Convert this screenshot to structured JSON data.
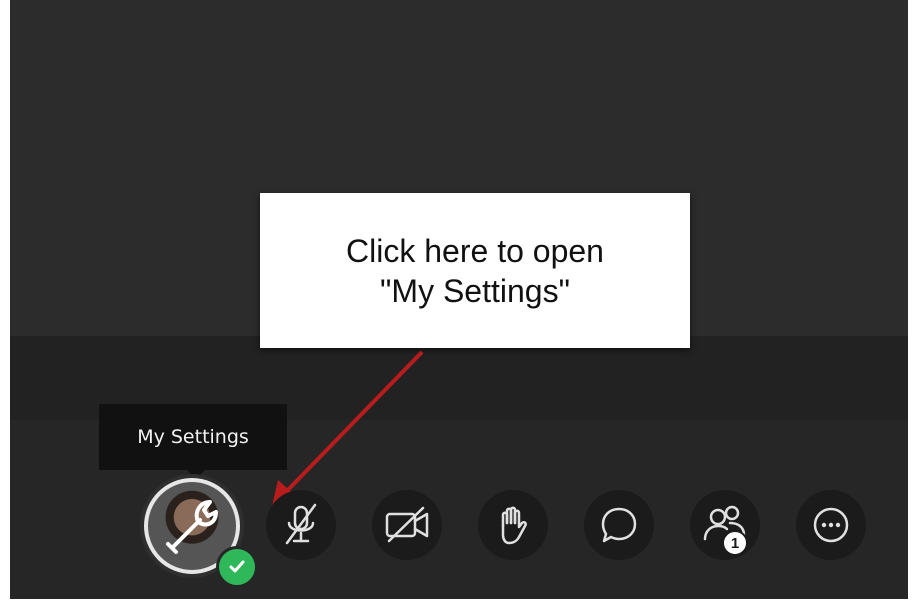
{
  "callout": {
    "line1": "Click here to open",
    "line2": "\"My Settings\""
  },
  "tooltip": {
    "label": "My Settings"
  },
  "controls": {
    "my_settings_icon": "wrench-icon",
    "status_icon": "check-icon",
    "mic_icon": "microphone-muted-icon",
    "camera_icon": "camera-off-icon",
    "hand_icon": "raise-hand-icon",
    "chat_icon": "chat-bubble-icon",
    "attendees_icon": "attendees-icon",
    "attendees_count": "1",
    "more_icon": "more-options-icon"
  },
  "colors": {
    "status_green": "#2fb85a",
    "arrow_red": "#b81c1c"
  }
}
